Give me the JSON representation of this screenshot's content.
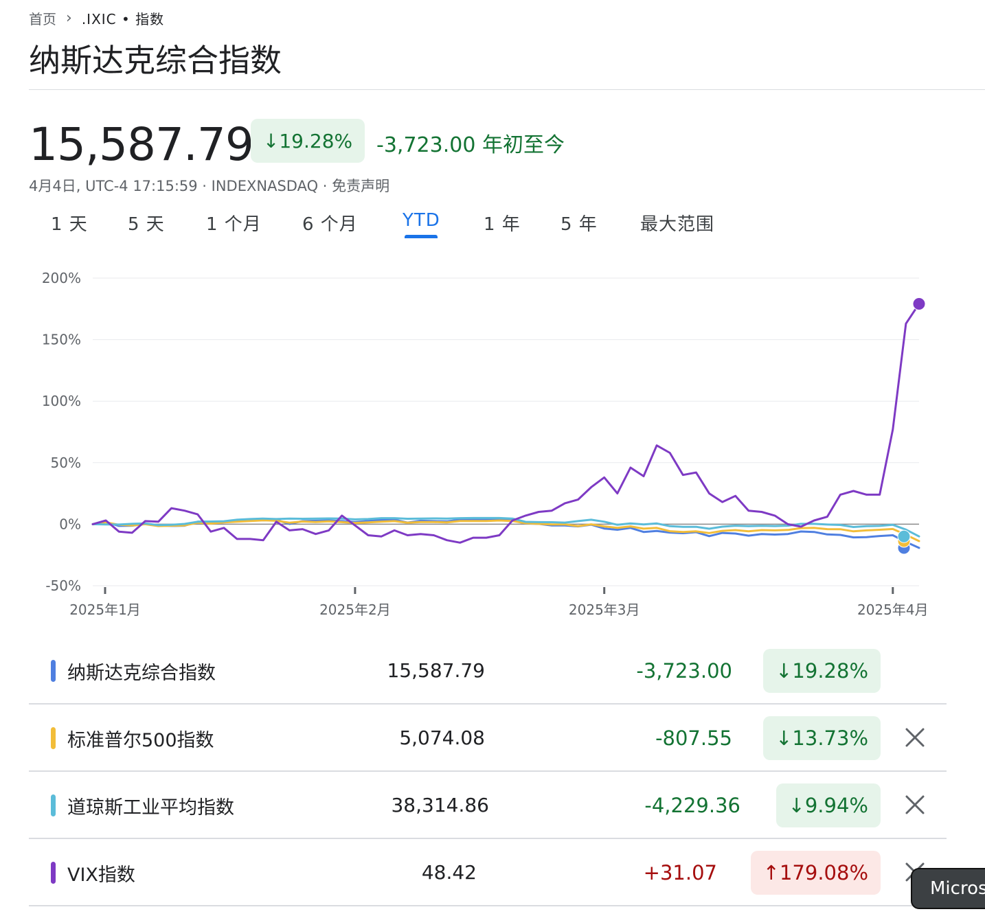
{
  "breadcrumb": {
    "home": "首页",
    "ticker": ".IXIC • 指数"
  },
  "title": "纳斯达克综合指数",
  "quote": {
    "price": "15,587.79",
    "pct_chip": "19.28%",
    "change_text": "-3,723.00 年初至今",
    "meta": "4月4日, UTC-4 17:15:59 · INDEXNASDAQ · 免责声明"
  },
  "tabs": [
    "1 天",
    "5 天",
    "1 个月",
    "6 个月",
    "YTD",
    "1 年",
    "5 年",
    "最大范围"
  ],
  "active_tab": "YTD",
  "colors": {
    "nasdaq": "#4f7fe0",
    "sp500": "#f2bd39",
    "dow": "#5bbcd9",
    "vix": "#7e3ac4",
    "gain": "#137333",
    "loss": "#a50e0e",
    "accent": "#1a73e8"
  },
  "chart_data": {
    "type": "line",
    "ylim": [
      -50,
      200
    ],
    "y_ticks": [
      "200%",
      "150%",
      "100%",
      "50%",
      "0%",
      "-50%"
    ],
    "x_ticks": [
      "2025年1月",
      "2025年2月",
      "2025年3月",
      "2025年4月"
    ],
    "x": [
      "1/2",
      "1/3",
      "1/6",
      "1/7",
      "1/8",
      "1/10",
      "1/13",
      "1/14",
      "1/15",
      "1/16",
      "1/17",
      "1/21",
      "1/22",
      "1/23",
      "1/24",
      "1/27",
      "1/28",
      "1/29",
      "1/30",
      "1/31",
      "2/3",
      "2/4",
      "2/5",
      "2/6",
      "2/7",
      "2/10",
      "2/11",
      "2/12",
      "2/13",
      "2/14",
      "2/18",
      "2/19",
      "2/20",
      "2/21",
      "2/24",
      "2/25",
      "2/26",
      "2/27",
      "2/28",
      "3/3",
      "3/4",
      "3/5",
      "3/6",
      "3/7",
      "3/10",
      "3/11",
      "3/12",
      "3/13",
      "3/14",
      "3/17",
      "3/18",
      "3/19",
      "3/20",
      "3/21",
      "3/24",
      "3/25",
      "3/26",
      "3/27",
      "3/28",
      "3/31",
      "4/1",
      "4/2",
      "4/3",
      "4/4"
    ],
    "series": [
      {
        "name": "纳斯达克综合指数",
        "values": [
          0,
          1.7,
          -1.4,
          -1.2,
          0.3,
          -1,
          -1.4,
          -1.2,
          2,
          2,
          1.8,
          2.5,
          3.5,
          3.2,
          3.5,
          0.2,
          2.5,
          2.8,
          3,
          2.5,
          1.8,
          2.6,
          3.4,
          3.6,
          1.3,
          2.8,
          2.5,
          2.3,
          3.7,
          4,
          3.6,
          3.7,
          3.2,
          0.6,
          0.3,
          -1,
          -1,
          -1.8,
          -0.4,
          -3.5,
          -4.5,
          -3,
          -6.3,
          -5.5,
          -6.8,
          -7.3,
          -6.5,
          -9.7,
          -7.1,
          -7.6,
          -9.3,
          -8,
          -8.4,
          -8,
          -5.9,
          -6.3,
          -8.3,
          -8.7,
          -10.7,
          -10.5,
          -9.6,
          -9,
          -14.4,
          -19.28
        ]
      },
      {
        "name": "标准普尔500指数",
        "values": [
          0,
          1.5,
          -0.5,
          -1,
          0,
          -1.5,
          -1.2,
          -1,
          1.2,
          0.5,
          1.5,
          2,
          2.6,
          3.1,
          2.8,
          1.2,
          2.2,
          1.8,
          2.3,
          1.7,
          1,
          1.5,
          2,
          2.5,
          1.2,
          1.8,
          1.8,
          1.5,
          2.6,
          2.6,
          2.6,
          3,
          2.6,
          0.8,
          0.3,
          -0.2,
          -0.1,
          -1.6,
          -0.1,
          -1.8,
          -3,
          -1.8,
          -3.6,
          -3,
          -5.7,
          -6.3,
          -5.8,
          -7.2,
          -5.4,
          -4.8,
          -5.8,
          -4.8,
          -5,
          -4.7,
          -3.2,
          -3,
          -4,
          -4.1,
          -5.8,
          -5,
          -4.5,
          -3.9,
          -8.6,
          -13.73
        ]
      },
      {
        "name": "道琼斯工业平均指数",
        "values": [
          0,
          -0.2,
          -0.3,
          0.3,
          0.6,
          -0.8,
          -0.5,
          0.2,
          2,
          2.2,
          2.4,
          3.6,
          4.2,
          4.6,
          4.2,
          4.5,
          4.4,
          4.5,
          4.7,
          4.6,
          3.9,
          4.2,
          4.9,
          4.9,
          4.4,
          4.6,
          4.7,
          4.6,
          4.9,
          5,
          5,
          5,
          4.6,
          1.9,
          1.7,
          1.6,
          1.3,
          2.5,
          3.6,
          2,
          -0.5,
          0.6,
          -0.2,
          0.6,
          -1.6,
          -2.1,
          -2.1,
          -3.7,
          -2,
          -1.2,
          -1.6,
          -1.3,
          -1.5,
          -1.2,
          0.3,
          0.3,
          -0.3,
          -0.6,
          -2.3,
          -1.6,
          -1.4,
          -0.5,
          -4.4,
          -9.94
        ]
      },
      {
        "name": "VIX指数",
        "values": [
          0,
          3,
          -6,
          -7,
          2.5,
          2,
          13,
          11,
          8,
          -6,
          -3,
          -12,
          -12,
          -13,
          2,
          -5,
          -4,
          -8,
          -5,
          7,
          -1,
          -9,
          -10,
          -5,
          -9,
          -8,
          -9,
          -13,
          -15,
          -11,
          -11,
          -9,
          3,
          7,
          10,
          11,
          17,
          20,
          30,
          38,
          25,
          46,
          39,
          64,
          58,
          40,
          42,
          25,
          18,
          23,
          11,
          10,
          7,
          0,
          -2,
          3,
          6,
          24,
          27,
          24,
          24,
          77,
          163,
          179.08
        ]
      }
    ]
  },
  "table": {
    "rows": [
      {
        "name": "纳斯达克综合指数",
        "value": "15,587.79",
        "change": "-3,723.00",
        "pct": "19.28%",
        "dir": "down",
        "closable": false
      },
      {
        "name": "标准普尔500指数",
        "value": "5,074.08",
        "change": "-807.55",
        "pct": "13.73%",
        "dir": "down",
        "closable": true
      },
      {
        "name": "道琼斯工业平均指数",
        "value": "38,314.86",
        "change": "-4,229.36",
        "pct": "9.94%",
        "dir": "down",
        "closable": true
      },
      {
        "name": "VIX指数",
        "value": "48.42",
        "change": "+31.07",
        "pct": "179.08%",
        "dir": "up",
        "closable": true
      }
    ]
  },
  "toast": {
    "text": "Micros"
  }
}
